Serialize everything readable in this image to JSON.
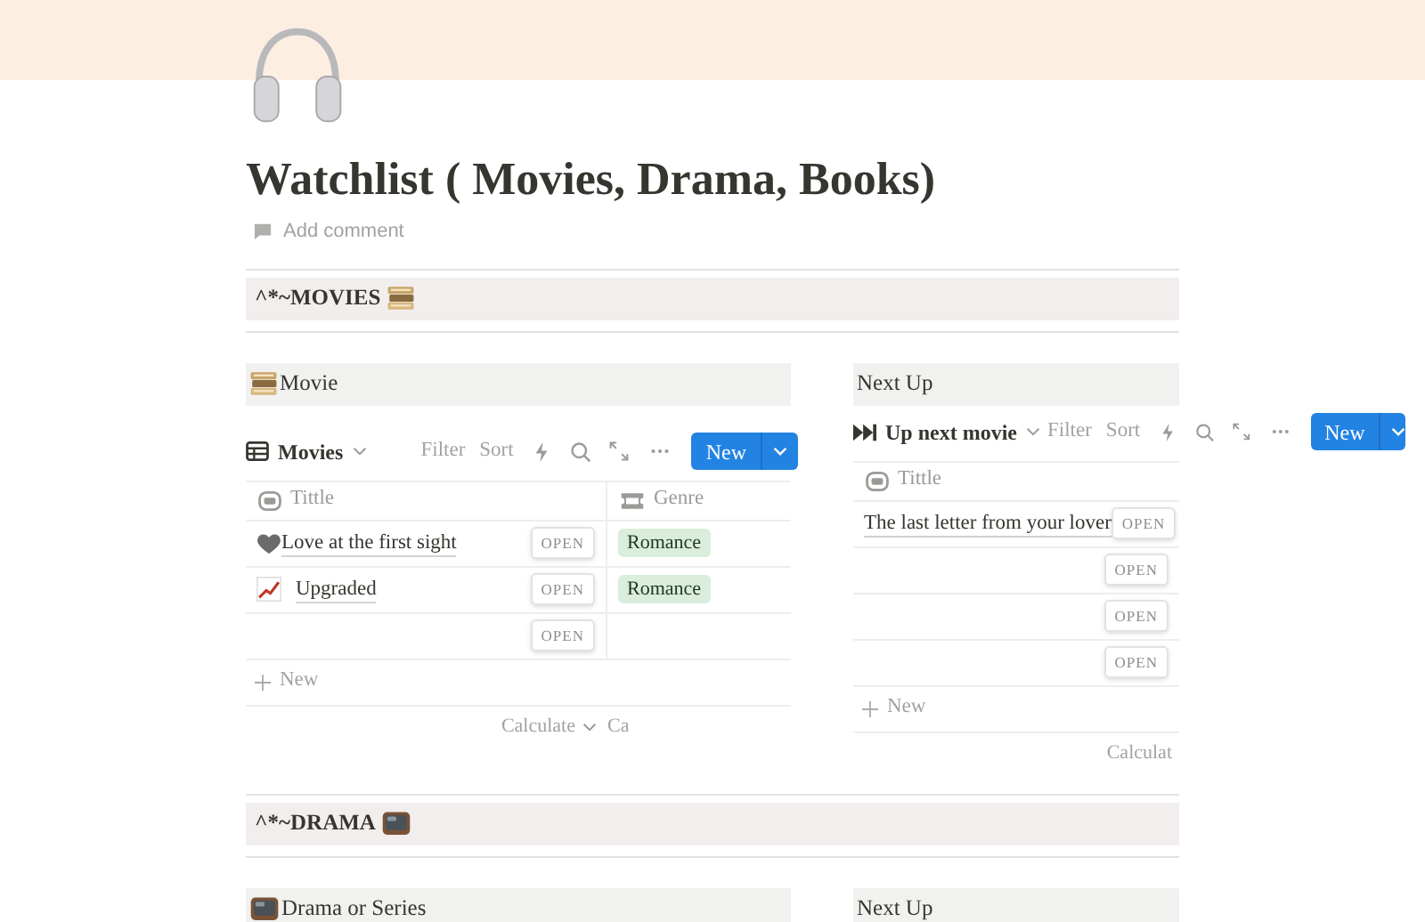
{
  "page": {
    "title": "Watchlist ( Movies, Drama, Books)",
    "add_comment": "Add comment"
  },
  "sections": [
    {
      "heading": "^*~MOVIES",
      "kind": "books",
      "left": {
        "heading": "Movie",
        "kind": "books",
        "view": {
          "name": "Movies",
          "kind": "table",
          "toolbar": [
            "Filter",
            "Sort"
          ],
          "new_button": "New",
          "columns": [
            {
              "name": "Tittle"
            },
            {
              "name": "Genre"
            }
          ],
          "rows": [
            {
              "title": "Love at the first sight",
              "kind": "heart",
              "open": "OPEN",
              "genre": "Romance"
            },
            {
              "title": "Upgraded",
              "kind": "chart",
              "open": "OPEN",
              "genre": "Romance"
            },
            {
              "open": "OPEN"
            }
          ],
          "add_row": "New",
          "footer": [
            {
              "label": "Calculate",
              "chevron": true
            },
            {
              "label": "Ca",
              "chevron": false
            }
          ]
        }
      },
      "right": {
        "heading": "Next Up",
        "view": {
          "name": "Up next movie",
          "kind": "skip",
          "toolbar": [
            "Filter",
            "Sort"
          ],
          "new_button": "New",
          "columns": [
            {
              "name": "Tittle"
            }
          ],
          "rows": [
            {
              "title": "The last letter from your lover",
              "open": "OPEN"
            },
            {
              "open": "OPEN"
            },
            {
              "open": "OPEN"
            },
            {
              "open": "OPEN"
            }
          ],
          "add_row": "New",
          "footer": [
            {
              "label": "Calculat",
              "chevron": false
            }
          ]
        }
      }
    },
    {
      "heading": "^*~DRAMA",
      "kind": "tv",
      "left": {
        "heading": "Drama or Series",
        "kind": "tv"
      },
      "right": {
        "heading": "Next Up"
      }
    }
  ]
}
